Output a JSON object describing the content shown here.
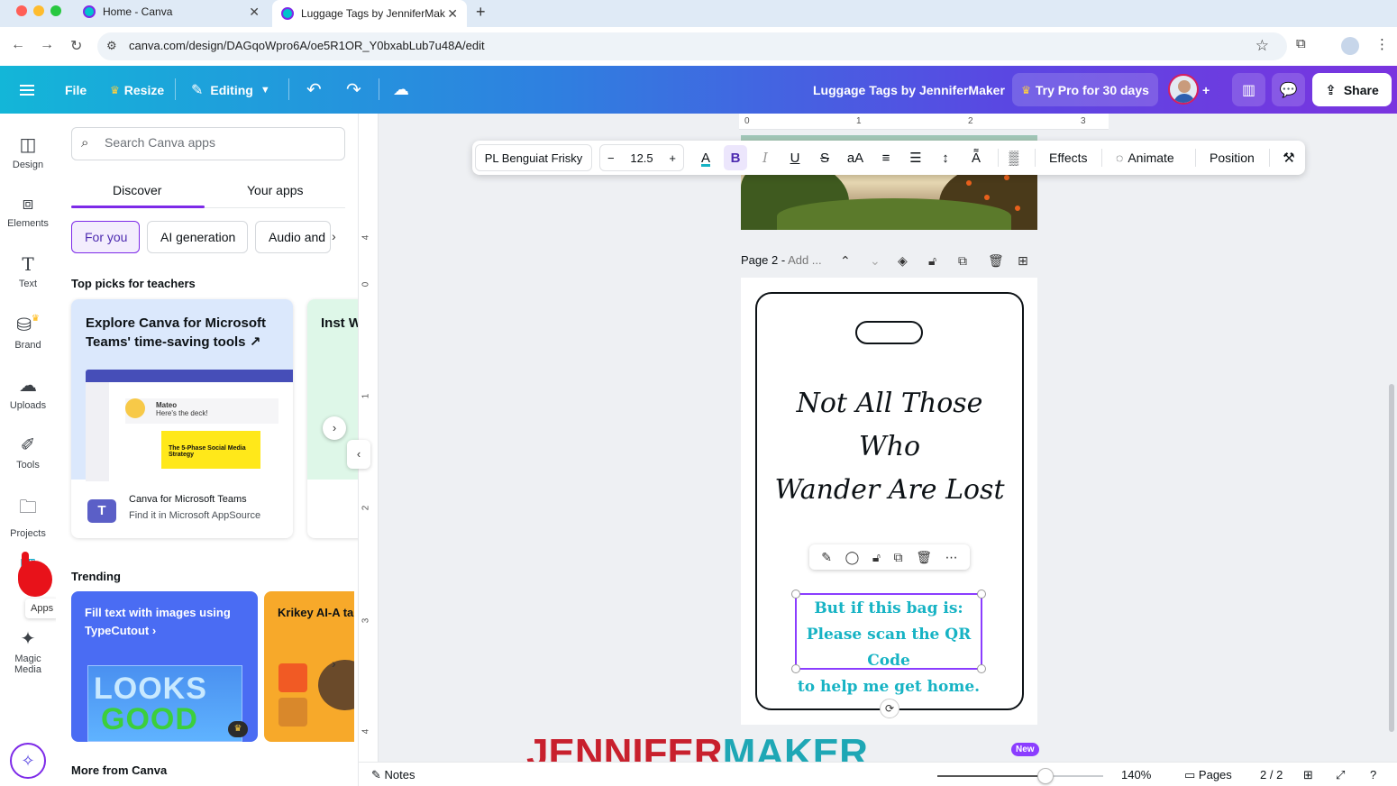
{
  "browser": {
    "tabs": [
      {
        "title": "Home - Canva"
      },
      {
        "title": "Luggage Tags by JenniferMak"
      }
    ],
    "url": "canva.com/design/DAGqoWpro6A/oe5R1OR_Y0bxabLub7u48A/edit"
  },
  "header": {
    "file": "File",
    "resize": "Resize",
    "editing": "Editing",
    "doc_title": "Luggage Tags by JenniferMaker",
    "try_pro": "Try Pro for 30 days",
    "share": "Share"
  },
  "rail": {
    "items": [
      {
        "label": "Design",
        "icon": "design-icon"
      },
      {
        "label": "Elements",
        "icon": "elements-icon"
      },
      {
        "label": "Text",
        "icon": "text-icon"
      },
      {
        "label": "Brand",
        "icon": "brand-icon"
      },
      {
        "label": "Uploads",
        "icon": "uploads-icon"
      },
      {
        "label": "Tools",
        "icon": "tools-icon"
      },
      {
        "label": "Projects",
        "icon": "projects-icon"
      },
      {
        "label": "Apps",
        "icon": "apps-icon"
      },
      {
        "label": "Magic Media",
        "icon": "magic-media-icon"
      }
    ],
    "apps_tooltip": "Apps"
  },
  "panel": {
    "search_placeholder": "Search Canva apps",
    "tabs": [
      "Discover",
      "Your apps"
    ],
    "chips": [
      "For you",
      "AI generation",
      "Audio and"
    ],
    "top_picks_title": "Top picks for teachers",
    "card_ms": {
      "title": "Explore Canva for Microsoft Teams' time-saving tools",
      "shot_name": "Mateo",
      "shot_msg": "Here's the deck!",
      "shot_post": "The 5-Phase Social Media Strategy",
      "name": "Canva for Microsoft Teams",
      "sub": "Find it in Microsoft AppSource"
    },
    "card_peek": {
      "title": "Inst Wo"
    },
    "trending_title": "Trending",
    "card_tc": {
      "title": "Fill text with images using TypeCutout",
      "word1": "LOOKS",
      "word2": "GOOD"
    },
    "card_kr": {
      "title": "Krikey AI-A talking avat"
    },
    "more_title": "More from Canva"
  },
  "toolbar": {
    "font": "PL Benguiat Frisky",
    "size": "12.5",
    "effects": "Effects",
    "animate": "Animate",
    "position": "Position"
  },
  "ruler": {
    "top": [
      "0",
      "1",
      "2",
      "3"
    ],
    "left": [
      "4",
      "0",
      "1",
      "2",
      "3",
      "4"
    ]
  },
  "page2": {
    "label": "Page 2 -",
    "add_title": "Add ...",
    "script_line1": "Not All Those Who",
    "script_line2": "Wander Are Lost",
    "sel_line1": "But if this bag is:",
    "sel_line2": "Please scan the QR Code",
    "sel_line3": "to help me get home."
  },
  "bottombar": {
    "notes": "Notes",
    "zoom": "140%",
    "zoom_level_percent": 65,
    "pages": "Pages",
    "page_count": "2 / 2",
    "new_badge": "New"
  },
  "watermark": {
    "part1": "JENNIFER",
    "part2": "MAKER"
  },
  "colors": {
    "accent": "#7d2ae8",
    "selected_text": "#17b3c4",
    "watermark_red": "#c8202d",
    "watermark_teal": "#1ea7b5"
  }
}
